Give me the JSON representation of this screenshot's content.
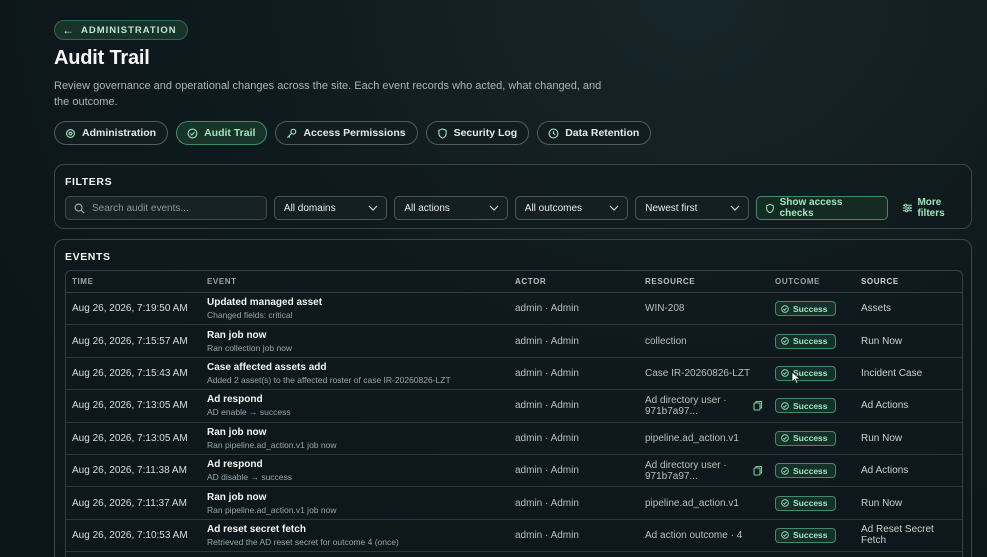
{
  "breadcrumb": {
    "label": "ADMINISTRATION"
  },
  "page": {
    "title": "Audit Trail",
    "description": "Review governance and operational changes across the site. Each event records who acted, what changed, and the outcome."
  },
  "tabs": [
    {
      "label": "Administration",
      "icon": "gear-icon"
    },
    {
      "label": "Audit Trail",
      "icon": "check-circle-icon",
      "active": true
    },
    {
      "label": "Access Permissions",
      "icon": "key-icon"
    },
    {
      "label": "Security Log",
      "icon": "shield-icon"
    },
    {
      "label": "Data Retention",
      "icon": "clock-icon"
    }
  ],
  "filters": {
    "title": "FILTERS",
    "search_placeholder": "Search audit events...",
    "domain": "All domains",
    "action": "All actions",
    "outcome": "All outcomes",
    "sort": "Newest first",
    "access_checks_label": "Show access checks",
    "more_filters_label": "More filters"
  },
  "events": {
    "title": "EVENTS",
    "columns": {
      "time": "TIME",
      "event": "EVENT",
      "actor": "ACTOR",
      "resource": "RESOURCE",
      "outcome": "OUTCOME",
      "source": "SOURCE"
    },
    "rows": [
      {
        "time": "Aug 26, 2026, 7:19:50 AM",
        "event": "Updated managed asset",
        "detail": "Changed fields: critical",
        "actor": "admin · Admin",
        "resource": "WIN-208",
        "resource2": "",
        "copy": false,
        "outcome": "Success",
        "source": "Assets"
      },
      {
        "time": "Aug 26, 2026, 7:15:57 AM",
        "event": "Ran job now",
        "detail": "Ran collection job now",
        "actor": "admin · Admin",
        "resource": "collection",
        "resource2": "",
        "copy": false,
        "outcome": "Success",
        "source": "Run Now"
      },
      {
        "time": "Aug 26, 2026, 7:15:43 AM",
        "event": "Case affected assets add",
        "detail": "Added 2 asset(s) to the affected roster of case IR-20260826-LZT",
        "actor": "admin · Admin",
        "resource": "Case IR-20260826-LZT",
        "resource2": "",
        "copy": false,
        "outcome": "Success",
        "source": "Incident Case"
      },
      {
        "time": "Aug 26, 2026, 7:13:05 AM",
        "event": "Ad respond",
        "detail": "AD enable → success",
        "actor": "admin · Admin",
        "resource": "Ad directory user ·",
        "resource2": "971b7a97...",
        "copy": true,
        "outcome": "Success",
        "source": "Ad Actions"
      },
      {
        "time": "Aug 26, 2026, 7:13:05 AM",
        "event": "Ran job now",
        "detail": "Ran pipeline.ad_action.v1 job now",
        "actor": "admin · Admin",
        "resource": "pipeline.ad_action.v1",
        "resource2": "",
        "copy": false,
        "outcome": "Success",
        "source": "Run Now"
      },
      {
        "time": "Aug 26, 2026, 7:11:38 AM",
        "event": "Ad respond",
        "detail": "AD disable → success",
        "actor": "admin · Admin",
        "resource": "Ad directory user ·",
        "resource2": "971b7a97...",
        "copy": true,
        "outcome": "Success",
        "source": "Ad Actions"
      },
      {
        "time": "Aug 26, 2026, 7:11:37 AM",
        "event": "Ran job now",
        "detail": "Ran pipeline.ad_action.v1 job now",
        "actor": "admin · Admin",
        "resource": "pipeline.ad_action.v1",
        "resource2": "",
        "copy": false,
        "outcome": "Success",
        "source": "Run Now"
      },
      {
        "time": "Aug 26, 2026, 7:10:53 AM",
        "event": "Ad reset secret fetch",
        "detail": "Retrieved the AD reset secret for outcome 4 (once)",
        "actor": "admin · Admin",
        "resource": "Ad action outcome · 4",
        "resource2": "",
        "copy": false,
        "outcome": "Success",
        "source": "Ad Reset Secret Fetch"
      }
    ]
  },
  "colors": {
    "accent": "#9fe6bd",
    "accent_border": "#3f8d66",
    "background": "#0f1a1e"
  }
}
